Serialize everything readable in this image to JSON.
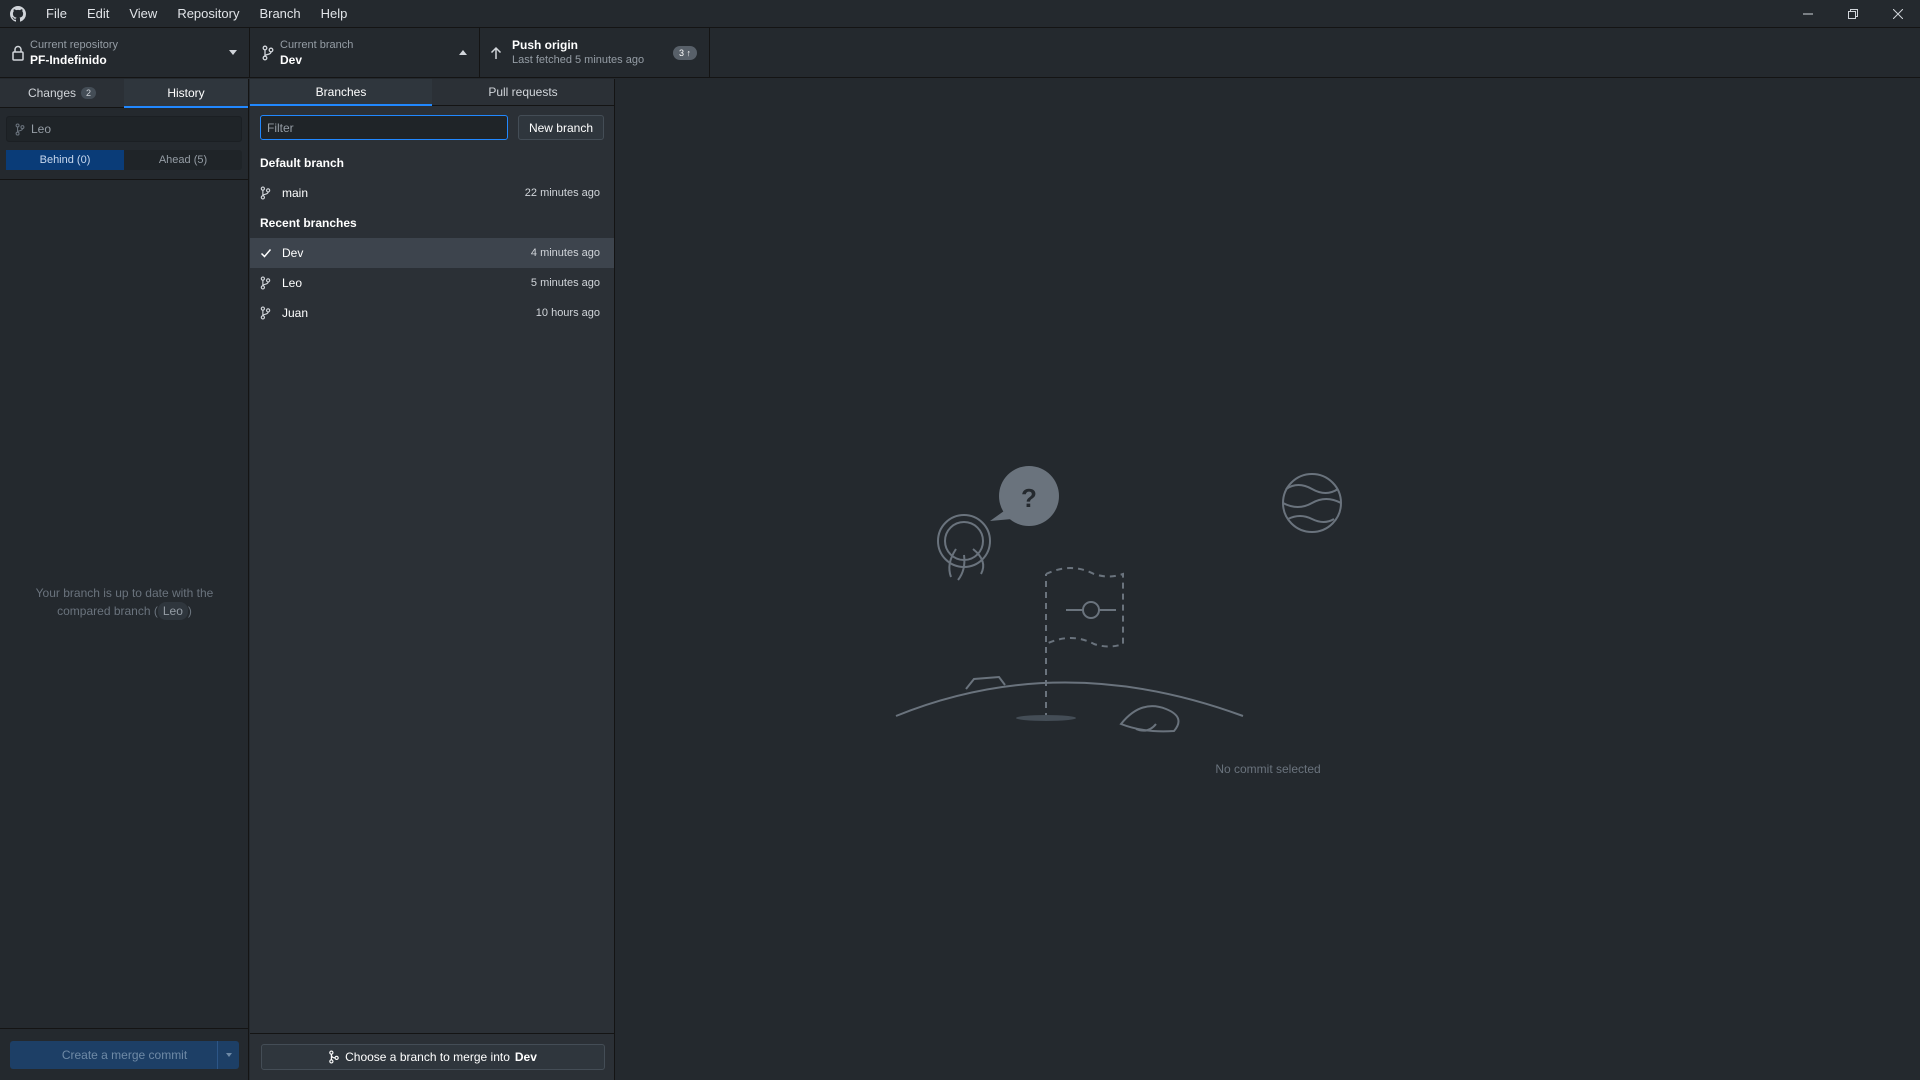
{
  "menubar": {
    "items": [
      "File",
      "Edit",
      "View",
      "Repository",
      "Branch",
      "Help"
    ]
  },
  "toolbar": {
    "repo_caption": "Current repository",
    "repo_name": "PF-Indefinido",
    "branch_caption": "Current branch",
    "branch_name": "Dev",
    "push_title": "Push origin",
    "push_sub": "Last fetched 5 minutes ago",
    "push_badge": "3 ↑"
  },
  "left": {
    "tab_changes": "Changes",
    "changes_count": "2",
    "tab_history": "History",
    "compare_value": "Leo",
    "behind": "Behind (0)",
    "ahead": "Ahead (5)",
    "uptodate_line1": "Your branch is up to date with the",
    "uptodate_line2_pre": "compared branch (",
    "uptodate_branch": "Leo",
    "uptodate_line2_post": ")",
    "merge_button": "Create a merge commit"
  },
  "branches": {
    "tab_branches": "Branches",
    "tab_prs": "Pull requests",
    "filter_placeholder": "Filter",
    "new_branch": "New branch",
    "default_header": "Default branch",
    "default": [
      {
        "name": "main",
        "time": "22 minutes ago"
      }
    ],
    "recent_header": "Recent branches",
    "recent": [
      {
        "name": "Dev",
        "time": "4 minutes ago",
        "current": true
      },
      {
        "name": "Leo",
        "time": "5 minutes ago"
      },
      {
        "name": "Juan",
        "time": "10 hours ago"
      }
    ],
    "merge_pre": "Choose a branch to merge into",
    "merge_target": "Dev"
  },
  "main": {
    "empty_text": "No commit selected"
  },
  "colors": {
    "accent": "#2188ff",
    "bg": "#24292e",
    "panel": "#2b3036"
  }
}
